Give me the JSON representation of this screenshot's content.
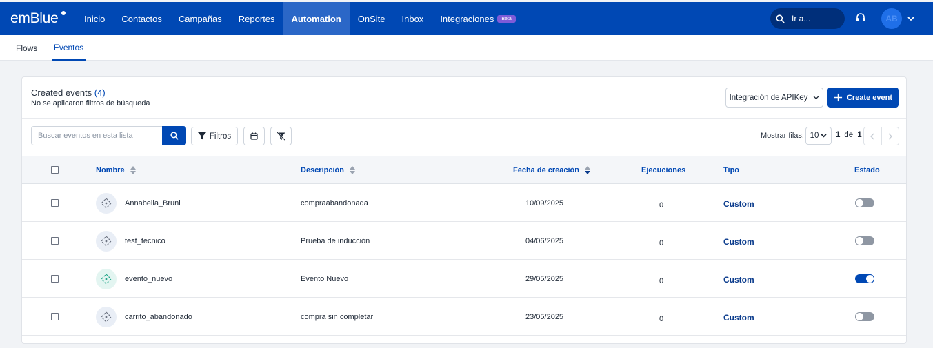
{
  "app": {
    "logo_text": "emBlue"
  },
  "nav": {
    "items": [
      {
        "label": "Inicio"
      },
      {
        "label": "Contactos"
      },
      {
        "label": "Campañas"
      },
      {
        "label": "Reportes"
      },
      {
        "label": "Automation",
        "active": true
      },
      {
        "label": "OnSite"
      },
      {
        "label": "Inbox"
      },
      {
        "label": "Integraciones",
        "badge": "Beta"
      }
    ],
    "search_label": "Ir a...",
    "avatar_initials": "AB"
  },
  "subnav": {
    "tabs": [
      {
        "label": "Flows"
      },
      {
        "label": "Eventos",
        "active": true
      }
    ]
  },
  "card": {
    "title": "Created events",
    "count": "(4)",
    "subtitle": "No se aplicaron filtros de búsqueda",
    "integration_button": "Integración de APIKey",
    "create_button": "Create event"
  },
  "toolbar": {
    "search_placeholder": "Buscar eventos en esta lista",
    "filters_label": "Filtros",
    "rows_label": "Mostrar filas:",
    "rows_value": "10",
    "page_current": "1",
    "page_of": "de",
    "page_total": "1"
  },
  "table": {
    "headers": {
      "name": "Nombre",
      "description": "Descripción",
      "created": "Fecha de creación",
      "executions": "Ejecuciones",
      "type": "Tipo",
      "status": "Estado"
    },
    "rows": [
      {
        "name": "Annabella_Bruni",
        "description": "compraabandonada",
        "date": "10/09/2025",
        "executions": "0",
        "type": "Custom",
        "enabled": false
      },
      {
        "name": "test_tecnico",
        "description": "Prueba de inducción",
        "date": "04/06/2025",
        "executions": "0",
        "type": "Custom",
        "enabled": false
      },
      {
        "name": "evento_nuevo",
        "description": "Evento Nuevo",
        "date": "29/05/2025",
        "executions": "0",
        "type": "Custom",
        "enabled": true
      },
      {
        "name": "carrito_abandonado",
        "description": "compra sin completar",
        "date": "23/05/2025",
        "executions": "0",
        "type": "Custom",
        "enabled": false
      }
    ]
  },
  "colors": {
    "primary": "#0048b4",
    "nav_active": "#2b67c7",
    "beta_badge": "#7e5bd8"
  }
}
